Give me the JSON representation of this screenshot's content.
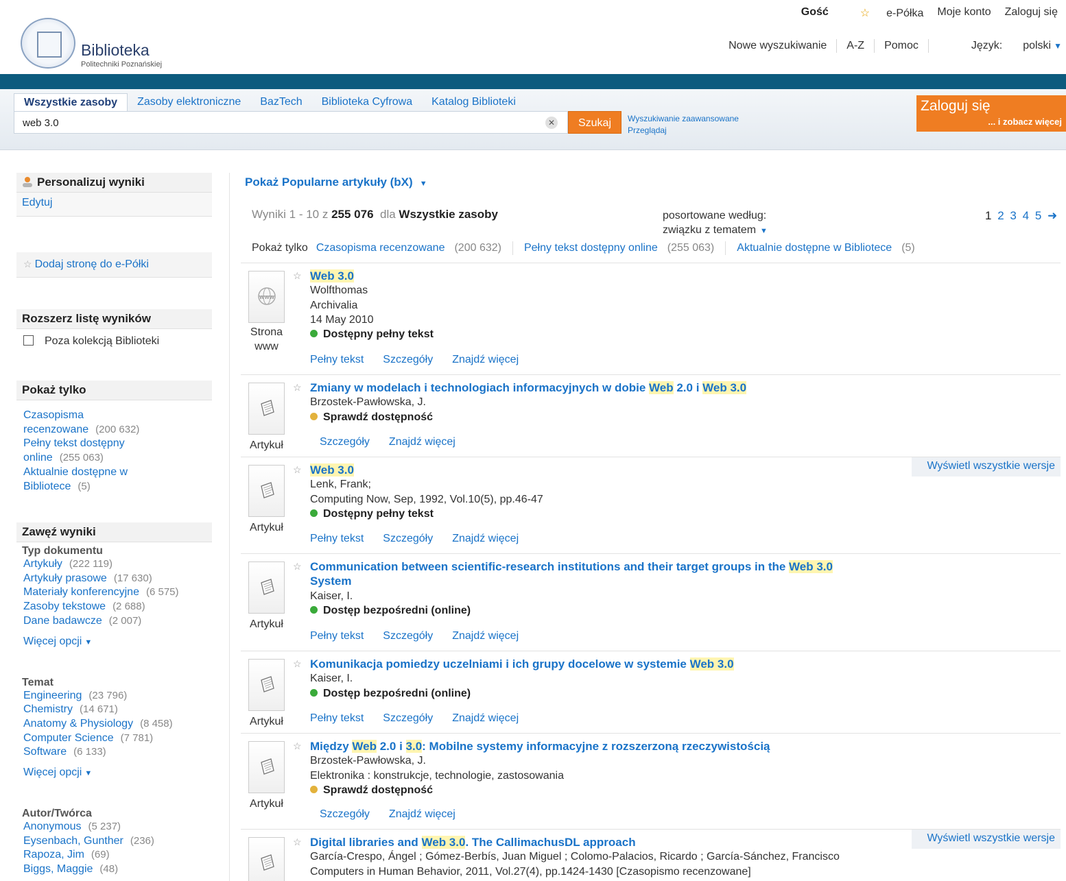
{
  "header": {
    "user_links": {
      "guest": "Gość",
      "eshelf": "e-Półka",
      "account": "Moje konto",
      "login": "Zaloguj się"
    },
    "logo": {
      "title": "Biblioteka",
      "subtitle": "Politechniki Poznańskiej"
    },
    "nav": {
      "new_search": "Nowe wyszukiwanie",
      "az": "A-Z",
      "help": "Pomoc",
      "language_label": "Język:",
      "language_value": "polski"
    }
  },
  "search": {
    "tabs": [
      "Wszystkie zasoby",
      "Zasoby elektroniczne",
      "BazTech",
      "Biblioteka Cyfrowa",
      "Katalog Biblioteki"
    ],
    "query": "web 3.0",
    "button": "Szukaj",
    "advanced": "Wyszukiwanie zaawansowane",
    "browse": "Przeglądaj"
  },
  "login_box": {
    "title": "Zaloguj się",
    "subtitle": "... i zobacz więcej"
  },
  "sidebar": {
    "personalize": {
      "title": "Personalizuj wyniki",
      "edit": "Edytuj"
    },
    "add_page": "Dodaj stronę do e-Półki",
    "expand": {
      "title": "Rozszerz listę wyników",
      "checkbox": "Poza kolekcją Biblioteki"
    },
    "show_only": {
      "title": "Pokaż tylko",
      "items": [
        {
          "line1": "Czasopisma",
          "line2": "recenzowane",
          "count": "(200 632)"
        },
        {
          "line1": "Pełny tekst dostępny",
          "line2": "online",
          "count": "(255 063)"
        },
        {
          "line1": "Aktualnie dostępne w",
          "line2": "Bibliotece",
          "count": "(5)"
        }
      ]
    },
    "narrow": {
      "title": "Zawęź wyniki",
      "doc_type": {
        "title": "Typ dokumentu",
        "items": [
          {
            "label": "Artykuły",
            "count": "(222 119)"
          },
          {
            "label": "Artykuły prasowe",
            "count": "(17 630)"
          },
          {
            "label": "Materiały konferencyjne",
            "count": "(6 575)"
          },
          {
            "label": "Zasoby tekstowe",
            "count": "(2 688)"
          },
          {
            "label": "Dane badawcze",
            "count": "(2 007)"
          }
        ],
        "more": "Więcej opcji"
      },
      "topic": {
        "title": "Temat",
        "items": [
          {
            "label": "Engineering",
            "count": "(23 796)"
          },
          {
            "label": "Chemistry",
            "count": "(14 671)"
          },
          {
            "label": "Anatomy & Physiology",
            "count": "(8 458)"
          },
          {
            "label": "Computer Science",
            "count": "(7 781)"
          },
          {
            "label": "Software",
            "count": "(6 133)"
          }
        ],
        "more": "Więcej opcji"
      },
      "author": {
        "title": "Autor/Twórca",
        "items": [
          {
            "label": "Anonymous",
            "count": "(5 237)"
          },
          {
            "label": "Eysenbach, Gunther",
            "count": "(236)"
          },
          {
            "label": "Rapoza, Jim",
            "count": "(69)"
          },
          {
            "label": "Biggs, Maggie",
            "count": "(48)"
          }
        ]
      }
    }
  },
  "results": {
    "popular": "Pokaż Popularne artykuły (bX)",
    "info": {
      "prefix": "Wyniki",
      "range": "1 - 10",
      "of": "z",
      "total": "255 076",
      "for": "dla",
      "scope": "Wszystkie zasoby"
    },
    "sort": {
      "label": "posortowane według:",
      "value": "związku z tematem"
    },
    "pager": [
      "1",
      "2",
      "3",
      "4",
      "5"
    ],
    "filters": {
      "label": "Pokaż tylko",
      "items": [
        {
          "label": "Czasopisma recenzowane",
          "count": "(200 632)"
        },
        {
          "label": "Pełny tekst dostępny online",
          "count": "(255 063)"
        },
        {
          "label": "Aktualnie dostępne w Bibliotece",
          "count": "(5)"
        }
      ]
    },
    "versions_label": "Wyświetl wszystkie wersje",
    "action_fulltext": "Pełny tekst",
    "action_details": "Szczegóły",
    "action_more": "Znajdź więcej",
    "items": [
      {
        "type": "Strona www",
        "title": [
          [
            "Web 3.0",
            true
          ]
        ],
        "lines": [
          "Wolfthomas",
          "Archivalia",
          "14 May 2010"
        ],
        "availability": "Dostępny pełny tekst",
        "status": "green",
        "fulltext": true
      },
      {
        "type": "Artykuł",
        "title": [
          [
            "Zmiany w modelach i technologiach informacyjnych w dobie ",
            false
          ],
          [
            "Web",
            true
          ],
          [
            " 2.0 i ",
            false
          ],
          [
            "Web 3.0",
            true
          ]
        ],
        "lines": [
          "Brzostek-Pawłowska, J."
        ],
        "availability": "Sprawdź dostępność",
        "status": "yellow",
        "fulltext": false
      },
      {
        "type": "Artykuł",
        "title": [
          [
            "Web 3.0",
            true
          ]
        ],
        "lines": [
          "Lenk, Frank;",
          "Computing Now, Sep, 1992, Vol.10(5), pp.46-47"
        ],
        "availability": "Dostępny pełny tekst",
        "status": "green",
        "fulltext": true,
        "versions": true
      },
      {
        "type": "Artykuł",
        "title": [
          [
            "Communication between scientific-research institutions and their target groups in the ",
            false
          ],
          [
            "Web 3.0",
            true
          ],
          [
            "\nSystem",
            false
          ]
        ],
        "lines": [
          "Kaiser, I."
        ],
        "availability": "Dostęp bezpośredni (online)",
        "status": "green",
        "fulltext": true
      },
      {
        "type": "Artykuł",
        "title": [
          [
            "Komunikacja pomiedzy uczelniami i ich grupy docelowe w systemie ",
            false
          ],
          [
            "Web 3.0",
            true
          ]
        ],
        "lines": [
          "Kaiser, I."
        ],
        "availability": "Dostęp bezpośredni (online)",
        "status": "green",
        "fulltext": true
      },
      {
        "type": "Artykuł",
        "title": [
          [
            "Między ",
            false
          ],
          [
            "Web",
            true
          ],
          [
            " 2.0 i ",
            false
          ],
          [
            "3.0",
            true
          ],
          [
            ": Mobilne systemy informacyjne z rozszerzoną rzeczywistością",
            false
          ]
        ],
        "lines": [
          "Brzostek-Pawłowska, J.",
          "Elektronika : konstrukcje, technologie, zastosowania"
        ],
        "availability": "Sprawdź dostępność",
        "status": "yellow",
        "fulltext": false
      },
      {
        "type": "Artykuł",
        "title": [
          [
            "Digital libraries and ",
            false
          ],
          [
            "Web 3.0",
            true
          ],
          [
            ". The CallimachusDL approach",
            false
          ]
        ],
        "lines": [
          "García-Crespo, Ángel ; Gómez-Berbís, Juan Miguel ; Colomo-Palacios, Ricardo ; García-Sánchez, Francisco",
          "Computers in Human Behavior, 2011, Vol.27(4), pp.1424-1430 [Czasopismo recenzowane]"
        ],
        "availability": "",
        "status": "",
        "fulltext": false,
        "versions": true
      }
    ]
  }
}
